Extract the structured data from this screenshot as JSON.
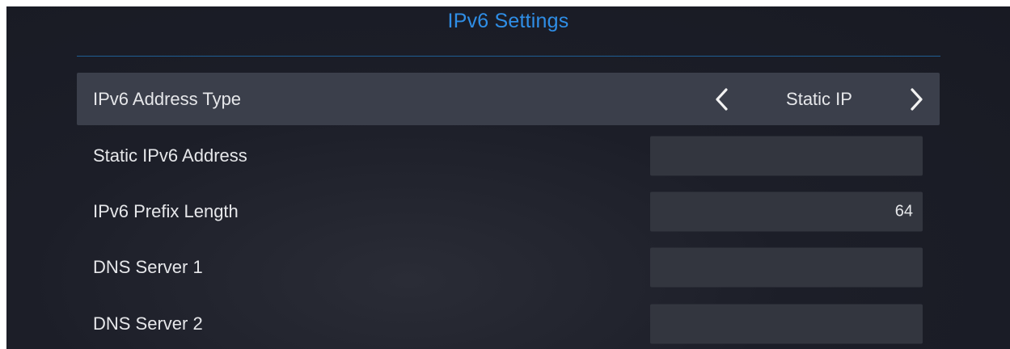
{
  "page": {
    "title": "IPv6 Settings"
  },
  "settings": {
    "address_type": {
      "label": "IPv6 Address Type",
      "value": "Static IP"
    },
    "static_address": {
      "label": "Static IPv6 Address",
      "value": ""
    },
    "prefix_length": {
      "label": "IPv6 Prefix Length",
      "value": "64"
    },
    "dns1": {
      "label": "DNS Server 1",
      "value": ""
    },
    "dns2": {
      "label": "DNS Server 2",
      "value": ""
    }
  },
  "colors": {
    "accent": "#2f8ee6",
    "background": "#1c1e28",
    "selected_row": "#3b3f4b",
    "field": "#33363f",
    "text": "#e6e7ea"
  },
  "icons": {
    "prev": "chevron-left-icon",
    "next": "chevron-right-icon"
  }
}
